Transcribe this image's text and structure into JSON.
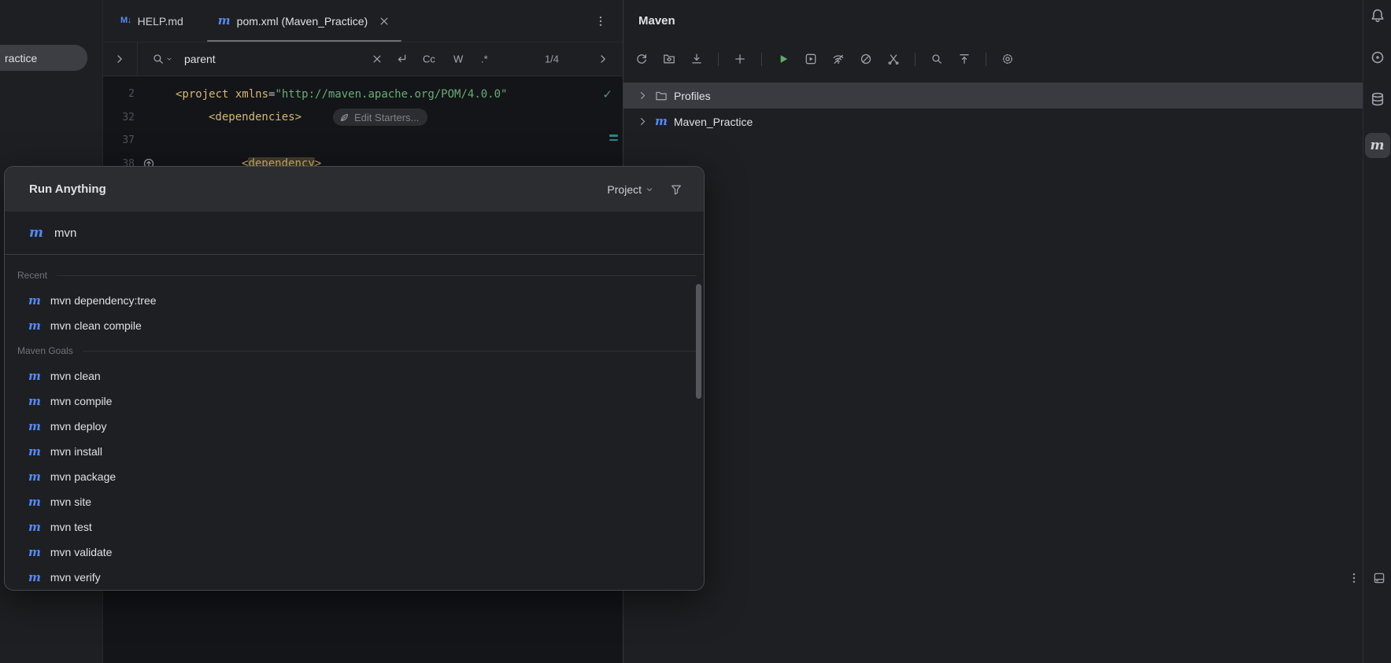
{
  "project_panel": {
    "selected_item": "ractice"
  },
  "tabs": {
    "items": [
      {
        "label": "HELP.md",
        "icon": "markdown-icon"
      },
      {
        "label": "pom.xml (Maven_Practice)",
        "icon": "maven-icon"
      }
    ]
  },
  "find_bar": {
    "query": "parent",
    "match_case": "Cc",
    "whole_words": "W",
    "regex": ".*",
    "match_count": "1/4"
  },
  "editor": {
    "lines": [
      {
        "number": "2",
        "indent": 0,
        "badge": "check",
        "tokens": [
          {
            "text": "<project ",
            "style": "tag"
          },
          {
            "text": "xmlns",
            "style": "attr"
          },
          {
            "text": "=",
            "style": "plain"
          },
          {
            "text": "\"http://maven.apache.org/POM/4.0.0\"",
            "style": "string"
          }
        ]
      },
      {
        "number": "32",
        "indent": 1,
        "inlay": "Edit Starters...",
        "tokens": [
          {
            "text": "<dependencies>",
            "style": "tag"
          }
        ]
      },
      {
        "number": "37",
        "indent": 2,
        "marks": true,
        "tokens": []
      },
      {
        "number": "38",
        "indent": 2,
        "gutter_icon": "arrow-up-circle-icon",
        "tokens": [
          {
            "text": "<",
            "style": "tag"
          },
          {
            "text": "dependency",
            "style": "tag",
            "highlight": true
          },
          {
            "text": ">",
            "style": "tag"
          }
        ]
      }
    ]
  },
  "maven": {
    "title": "Maven",
    "toolbar_groups": [
      [
        "sync-icon",
        "generate-sources-icon",
        "download-sources-icon"
      ],
      [
        "add-icon"
      ],
      [
        "run-icon",
        "execute-goal-icon",
        "offline-mode-icon",
        "skip-tests-icon",
        "mute-tests-icon"
      ],
      [
        "search-icon",
        "collapse-all-icon"
      ],
      [
        "settings-icon"
      ]
    ],
    "tree": [
      {
        "label": "Profiles",
        "icon": "folder-icon",
        "selected": true
      },
      {
        "label": "Maven_Practice",
        "icon": "maven-icon",
        "selected": false
      }
    ]
  },
  "right_stripe": {
    "top_icons": [
      "notifications-icon",
      "ai-assistant-icon",
      "database-icon"
    ],
    "active_tool_icon": "maven-icon",
    "bottom_icons": [
      "more-vertical-icon",
      "dock-icon"
    ]
  },
  "run_anything": {
    "title": "Run Anything",
    "scope": "Project",
    "query": "mvn",
    "sections": [
      {
        "header": "Recent",
        "items": [
          "mvn dependency:tree",
          "mvn clean compile"
        ]
      },
      {
        "header": "Maven Goals",
        "items": [
          "mvn clean",
          "mvn compile",
          "mvn deploy",
          "mvn install",
          "mvn package",
          "mvn site",
          "mvn test",
          "mvn validate",
          "mvn verify"
        ]
      }
    ]
  },
  "colors": {
    "accent": "#548AF7",
    "selection": "#393B40",
    "run_green": "#5FAD65",
    "check_green": "#57965C",
    "xml_tag": "#D5B778",
    "xml_string": "#6AAB73",
    "teal_mark": "#2E8486"
  }
}
